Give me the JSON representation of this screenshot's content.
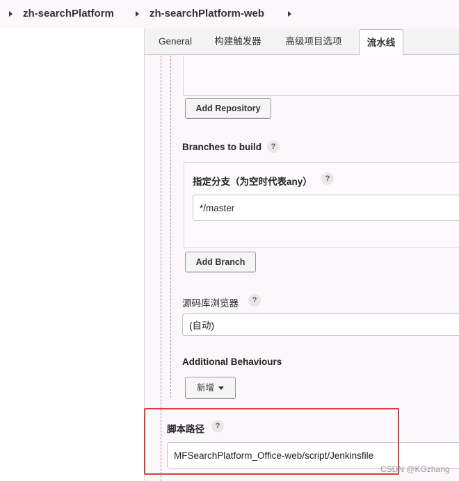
{
  "breadcrumb": {
    "items": [
      "zh-searchPlatform",
      "zh-searchPlatform-web"
    ]
  },
  "tabs": [
    {
      "label": "General"
    },
    {
      "label": "构建触发器"
    },
    {
      "label": "高级项目选项"
    },
    {
      "label": "流水线",
      "active": true
    }
  ],
  "scm": {
    "add_repository_label": "Add Repository",
    "branches_label": "Branches to build",
    "branch_spec_label": "指定分支（为空时代表any）",
    "branch_spec_value": "*/master",
    "add_branch_label": "Add Branch",
    "repo_browser_label": "源码库浏览器",
    "repo_browser_value": "(自动)",
    "additional_behaviours_label": "Additional Behaviours",
    "add_new_label": "新增"
  },
  "script": {
    "script_path_label": "脚本路径",
    "script_path_value": "MFSearchPlatform_Office-web/script/Jenkinsfile"
  },
  "help_glyph": "?",
  "watermark": "CSDN @KGzhang",
  "colors": {
    "highlight": "#e23a3a",
    "background": "#fbf7fb"
  }
}
